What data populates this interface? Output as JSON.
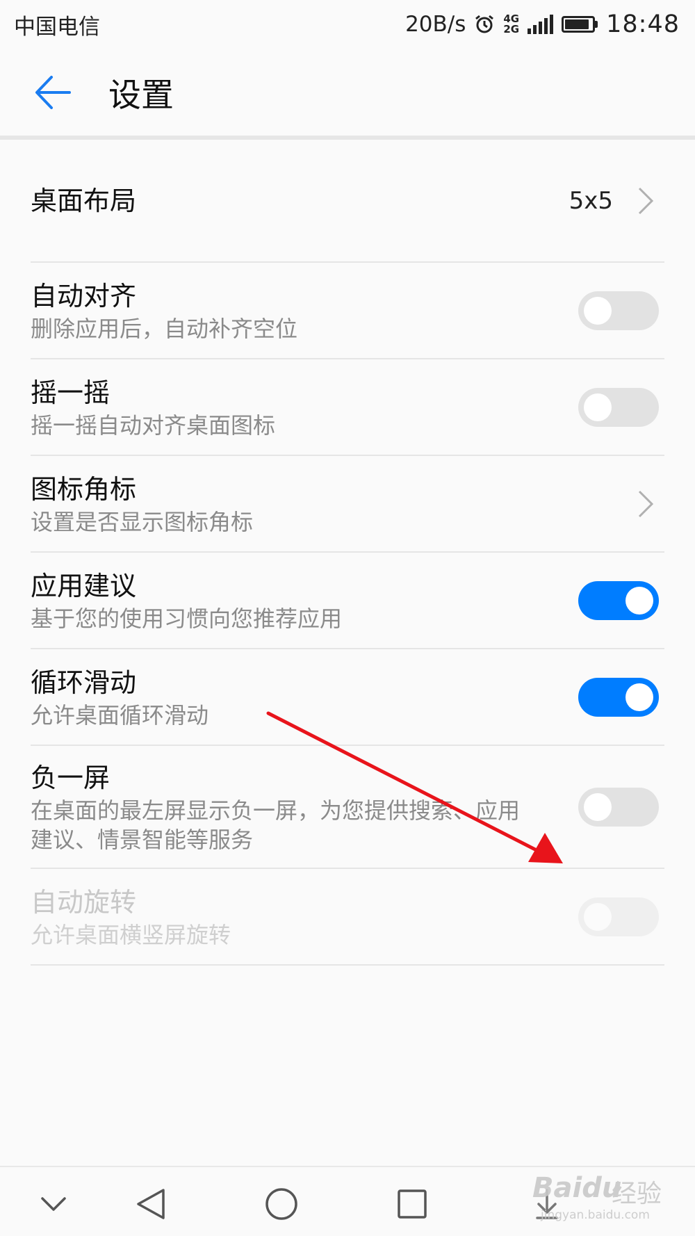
{
  "status_bar": {
    "carrier": "中国电信",
    "net_speed": "20B/s",
    "net_type_top": "4G",
    "net_type_bottom": "2G",
    "time": "18:48",
    "battery_level": 0.9
  },
  "app_bar": {
    "title": "设置",
    "back_icon": "arrow-left-icon"
  },
  "settings": [
    {
      "id": "desktop-layout",
      "title": "桌面布局",
      "subtitle": "",
      "control": "chevron",
      "value": "5x5"
    },
    {
      "id": "auto-align",
      "title": "自动对齐",
      "subtitle": "删除应用后，自动补齐空位",
      "control": "toggle",
      "checked": false
    },
    {
      "id": "shake",
      "title": "摇一摇",
      "subtitle": "摇一摇自动对齐桌面图标",
      "control": "toggle",
      "checked": false
    },
    {
      "id": "icon-badge",
      "title": "图标角标",
      "subtitle": "设置是否显示图标角标",
      "control": "chevron",
      "value": ""
    },
    {
      "id": "app-suggest",
      "title": "应用建议",
      "subtitle": "基于您的使用习惯向您推荐应用",
      "control": "toggle",
      "checked": true
    },
    {
      "id": "loop-scroll",
      "title": "循环滑动",
      "subtitle": "允许桌面循环滑动",
      "control": "toggle",
      "checked": true
    },
    {
      "id": "minus-one-screen",
      "title": "负一屏",
      "subtitle": "在桌面的最左屏显示负一屏，为您提供搜索、应用建议、情景智能等服务",
      "control": "toggle",
      "checked": false
    },
    {
      "id": "auto-rotate",
      "title": "自动旋转",
      "subtitle": "允许桌面横竖屏旋转",
      "control": "toggle",
      "checked": false,
      "disabled": true
    }
  ],
  "nav_bar": {
    "icons": [
      "chevron-down-icon",
      "back-triangle-icon",
      "home-circle-icon",
      "recents-square-icon",
      "download-icon"
    ]
  },
  "watermark": {
    "brand": "Baidu",
    "cn": "经验",
    "url": "jingyan.baidu.com"
  },
  "colors": {
    "accent": "#007dff",
    "annotation": "#e8141b"
  }
}
